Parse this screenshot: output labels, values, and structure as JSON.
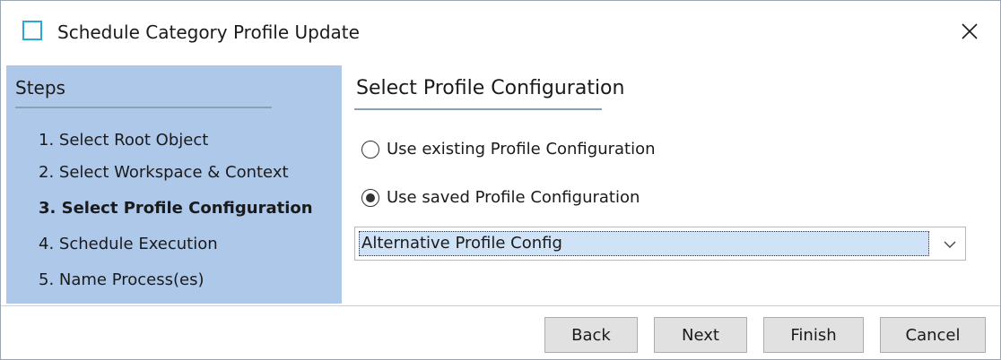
{
  "window": {
    "title": "Schedule Category Profile Update",
    "icon": "window-icon",
    "close_icon": "close-icon"
  },
  "sidebar": {
    "heading": "Steps",
    "steps": [
      {
        "label": "1. Select Root Object",
        "active": false
      },
      {
        "label": "2. Select Workspace & Context",
        "active": false
      },
      {
        "label": "3. Select Profile Configuration",
        "active": true
      },
      {
        "label": "4. Schedule Execution",
        "active": false
      },
      {
        "label": "5. Name Process(es)",
        "active": false
      }
    ]
  },
  "content": {
    "heading": "Select Profile Configuration",
    "options": [
      {
        "label": "Use existing Profile Configuration",
        "selected": false
      },
      {
        "label": "Use saved Profile Configuration",
        "selected": true
      }
    ],
    "dropdown": {
      "selected": "Alternative Profile Config",
      "arrow_icon": "chevron-down-icon"
    }
  },
  "footer": {
    "back_label": "Back",
    "next_label": "Next",
    "finish_label": "Finish",
    "cancel_label": "Cancel"
  },
  "colors": {
    "sidebar_bg": "#aec8ea",
    "accent": "#2aa9d6",
    "selection_bg": "#cfe2f6",
    "button_bg": "#e1e1e1"
  }
}
